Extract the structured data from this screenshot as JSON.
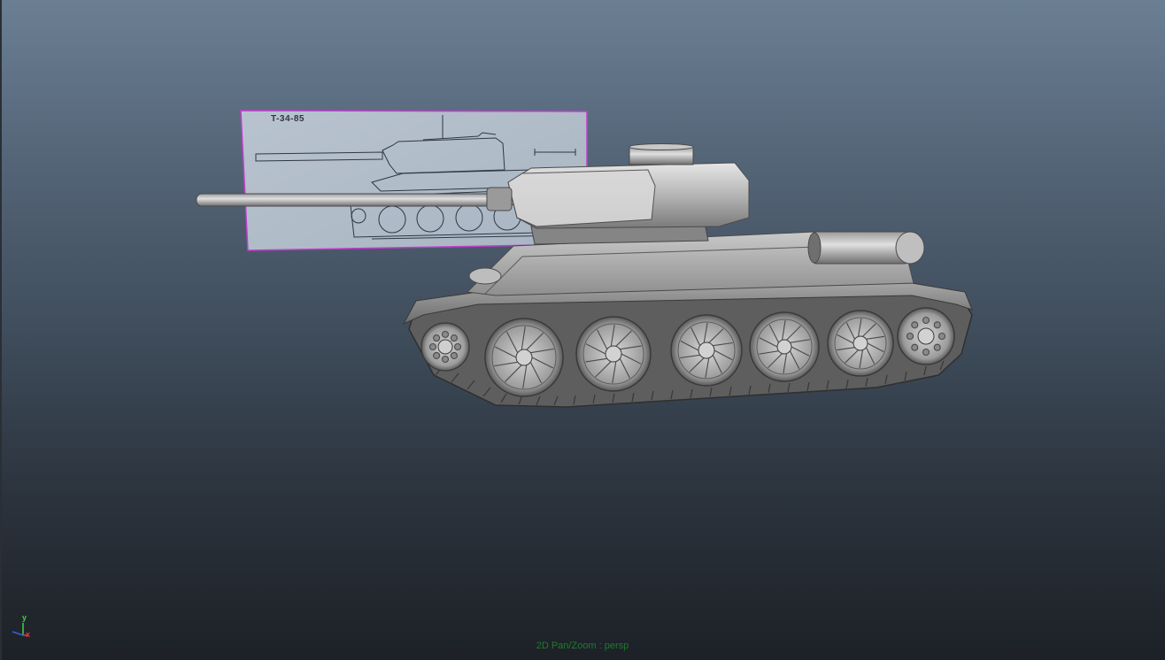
{
  "viewport": {
    "camera": "persp",
    "hud_message": "2D Pan/Zoom : persp"
  },
  "image_plane": {
    "label": "T-34-85"
  },
  "axis_gizmo": {
    "y_label": "y",
    "x_label": "x",
    "colors": {
      "y": "#3fd13f",
      "x": "#e03a3a",
      "z": "#3a5ae0"
    }
  },
  "colors": {
    "selection_highlight": "#c43ccf",
    "hud_text": "#1f7a2e"
  }
}
